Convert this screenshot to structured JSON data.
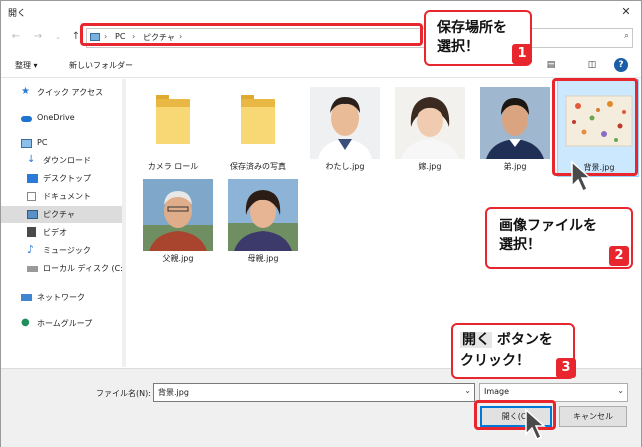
{
  "window": {
    "title": "開く"
  },
  "address": {
    "crumbs": [
      "PC",
      "ピクチャ"
    ],
    "sep": "›",
    "end_sep": "›"
  },
  "toolbar": {
    "organize": "整理 ▾",
    "new_folder": "新しいフォルダー"
  },
  "nav_pane": {
    "items": [
      {
        "label": "クイック アクセス",
        "icon": "star-icon"
      },
      {
        "label": "OneDrive",
        "icon": "cloud-icon"
      },
      {
        "label": "PC",
        "icon": "pc-icon"
      },
      {
        "label": "ダウンロード",
        "icon": "download-icon"
      },
      {
        "label": "デスクトップ",
        "icon": "desktop-icon"
      },
      {
        "label": "ドキュメント",
        "icon": "document-icon"
      },
      {
        "label": "ピクチャ",
        "icon": "pictures-icon",
        "selected": true
      },
      {
        "label": "ビデオ",
        "icon": "video-icon"
      },
      {
        "label": "ミュージック",
        "icon": "music-icon"
      },
      {
        "label": "ローカル ディスク (C:)",
        "icon": "disk-icon"
      },
      {
        "label": "ネットワーク",
        "icon": "network-icon"
      },
      {
        "label": "ホームグループ",
        "icon": "homegroup-icon"
      }
    ]
  },
  "files": [
    {
      "label": "カメラ ロール",
      "kind": "folder"
    },
    {
      "label": "保存済みの写真",
      "kind": "folder"
    },
    {
      "label": "わたし.jpg",
      "kind": "photo"
    },
    {
      "label": "嫁.jpg",
      "kind": "photo"
    },
    {
      "label": "弟.jpg",
      "kind": "photo"
    },
    {
      "label": "背景.jpg",
      "kind": "photo",
      "selected": true
    },
    {
      "label": "父親.jpg",
      "kind": "photo"
    },
    {
      "label": "母親.jpg",
      "kind": "photo"
    }
  ],
  "bottom": {
    "filename_label": "ファイル名(N):",
    "filename_value": "背景.jpg",
    "filetype_value": "Image",
    "open_button": "開く(O)",
    "cancel_button": "キャンセル"
  },
  "callouts": [
    {
      "text": "保存場所を\n選択！",
      "badge": "1"
    },
    {
      "text": "画像ファイルを\n選択！",
      "badge": "2"
    },
    {
      "text_key": "開く",
      "text_rest": " ボタンを",
      "text_line2": "クリック！",
      "badge": "3"
    }
  ],
  "colors": {
    "accent_red": "#e8262d",
    "selection_blue": "#cce8ff"
  }
}
